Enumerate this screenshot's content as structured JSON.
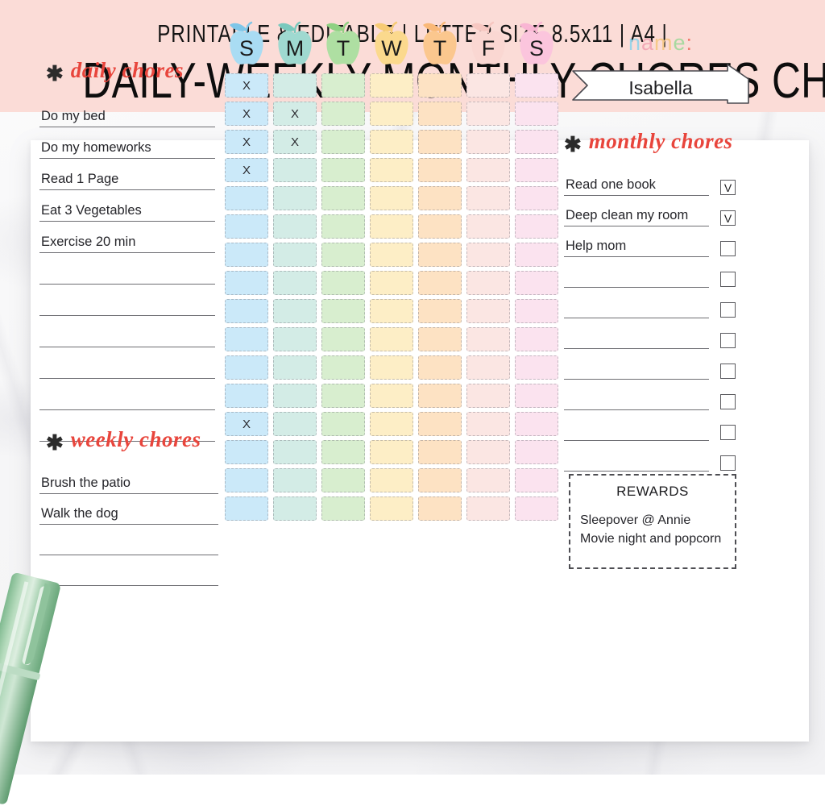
{
  "banner": {
    "line1": "PRINTABLE & EDITABLE | LETTER SIZE 8.5x11 | A4 |",
    "line2": "DAILY-WEEKLY-MONTHLY CHORES CHART"
  },
  "daily": {
    "star": "✱",
    "title": "daily chores",
    "items": [
      "Do my bed",
      "Do my homeworks",
      "Read 1 Page",
      "Eat 3 Vegetables",
      "Exercise 20 min",
      "",
      "",
      "",
      "",
      "",
      ""
    ]
  },
  "weekly": {
    "star": "✱",
    "title": "weekly chores",
    "items": [
      "Brush the patio",
      "Walk the dog",
      "",
      ""
    ]
  },
  "name": {
    "label_letters": [
      "n",
      "a",
      "m",
      "e",
      ":"
    ],
    "value": "Isabella"
  },
  "monthly": {
    "star": "✱",
    "title": "monthly chores",
    "items": [
      {
        "text": "Read one book",
        "check": "V"
      },
      {
        "text": "Deep clean my room",
        "check": "V"
      },
      {
        "text": "Help mom",
        "check": ""
      },
      {
        "text": "",
        "check": ""
      },
      {
        "text": "",
        "check": ""
      },
      {
        "text": "",
        "check": ""
      },
      {
        "text": "",
        "check": ""
      },
      {
        "text": "",
        "check": ""
      },
      {
        "text": "",
        "check": ""
      },
      {
        "text": "",
        "check": ""
      }
    ]
  },
  "rewards": {
    "title": "REWARDS",
    "items": [
      "Sleepover @ Annie",
      "Movie night and popcorn"
    ]
  },
  "grid": {
    "days": [
      {
        "letter": "S",
        "apple": "#a9dcf3",
        "leaf": "#7ec6e8"
      },
      {
        "letter": "M",
        "apple": "#9fd9d0",
        "leaf": "#79c9bd"
      },
      {
        "letter": "T",
        "apple": "#aedfa2",
        "leaf": "#8fd182"
      },
      {
        "letter": "W",
        "apple": "#fbd98d",
        "leaf": "#f7cb74"
      },
      {
        "letter": "T",
        "apple": "#fbc78e",
        "leaf": "#f9b877"
      },
      {
        "letter": "F",
        "apple": "#fad7d2",
        "leaf": "#f7c7c1"
      },
      {
        "letter": "S",
        "apple": "#fbc5dd",
        "leaf": "#f9b5d3"
      }
    ],
    "cell_colors": [
      "#cbe9f9",
      "#d3ece6",
      "#d8eecf",
      "#fdeec6",
      "#fde2c3",
      "#fbe6e3",
      "#fbe3ef"
    ],
    "rows": 16,
    "marks": [
      [
        "X",
        "",
        "",
        "",
        "",
        "",
        ""
      ],
      [
        "X",
        "X",
        "",
        "",
        "",
        "",
        ""
      ],
      [
        "X",
        "X",
        "",
        "",
        "",
        "",
        ""
      ],
      [
        "X",
        "",
        "",
        "",
        "",
        "",
        ""
      ],
      [
        "",
        "",
        "",
        "",
        "",
        "",
        ""
      ],
      [
        "",
        "",
        "",
        "",
        "",
        "",
        ""
      ],
      [
        "",
        "",
        "",
        "",
        "",
        "",
        ""
      ],
      [
        "",
        "",
        "",
        "",
        "",
        "",
        ""
      ],
      [
        "",
        "",
        "",
        "",
        "",
        "",
        ""
      ],
      [
        "",
        "",
        "",
        "",
        "",
        "",
        ""
      ],
      [
        "",
        "",
        "",
        "",
        "",
        "",
        ""
      ],
      [
        "",
        "",
        "",
        "",
        "",
        "",
        ""
      ],
      [
        "X",
        "",
        "",
        "",
        "",
        "",
        ""
      ],
      [
        "",
        "",
        "",
        "",
        "",
        "",
        ""
      ],
      [
        "",
        "",
        "",
        "",
        "",
        "",
        ""
      ],
      [
        "",
        "",
        "",
        "",
        "",
        "",
        ""
      ]
    ]
  }
}
